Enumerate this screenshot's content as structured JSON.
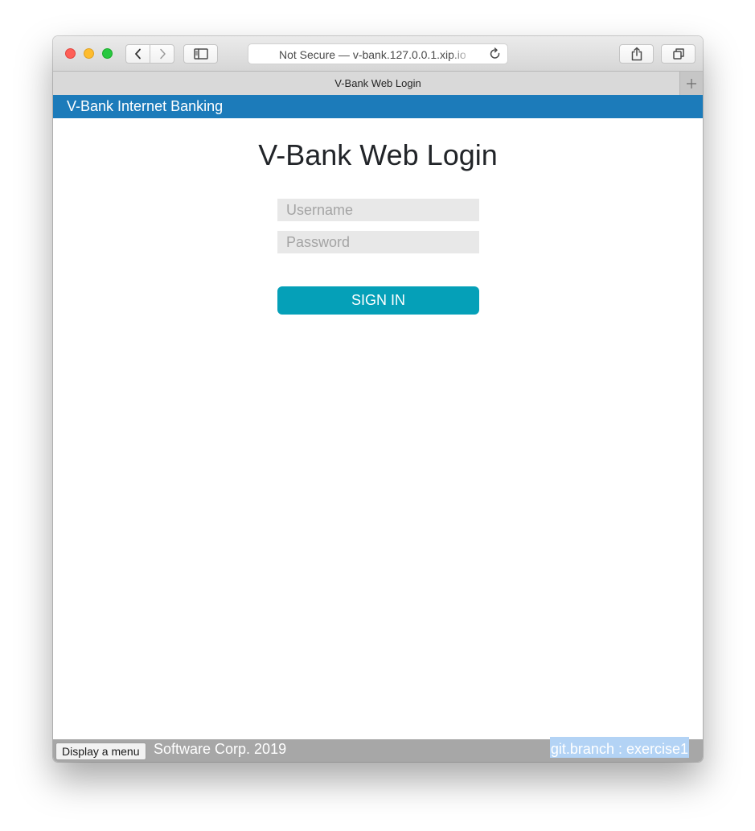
{
  "browser": {
    "address_text": "Not Secure — v-bank.127.0.0.1.xip.io",
    "tab_title": "V-Bank Web Login",
    "icons": {
      "back": "chevron-left-icon",
      "forward": "chevron-right-icon",
      "sidebar": "sidebar-icon",
      "reload": "reload-icon",
      "share": "share-icon",
      "tabs": "tabs-overview-icon",
      "new_tab": "plus-icon"
    }
  },
  "header": {
    "title": "V-Bank Internet Banking",
    "color": "#1c7bba"
  },
  "login": {
    "title": "V-Bank Web Login",
    "username_placeholder": "Username",
    "username_value": "",
    "password_placeholder": "Password",
    "password_value": "",
    "signin_label": "SIGN IN",
    "signin_color": "#05a0b8"
  },
  "footer": {
    "menu_button_label": "Display a menu",
    "copyright": "Software Corp. 2019",
    "branch": "git.branch : exercise1"
  }
}
